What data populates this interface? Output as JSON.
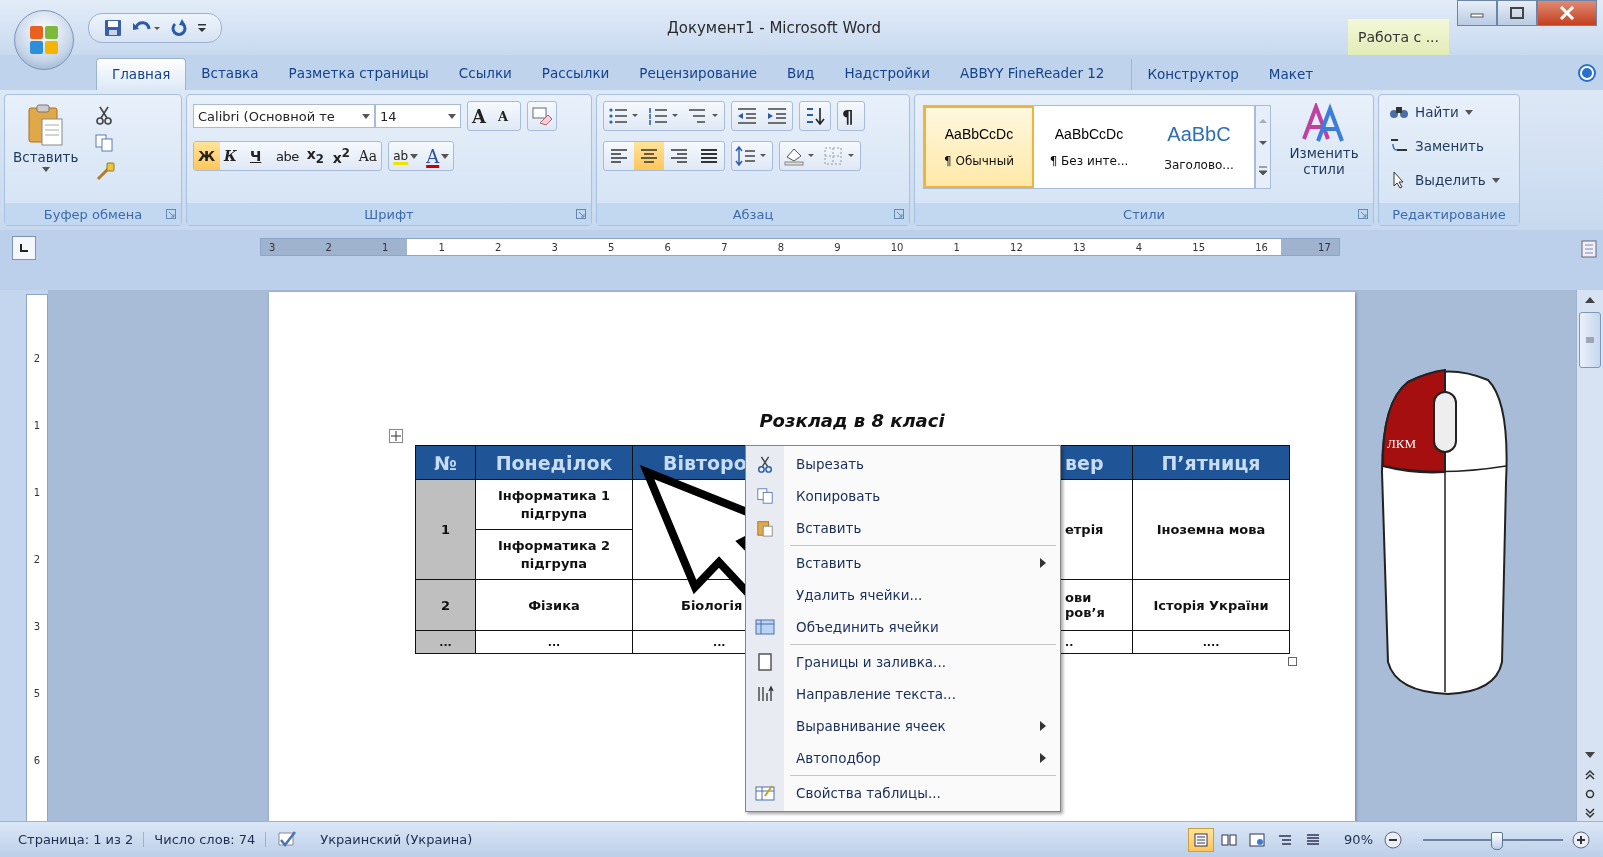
{
  "window": {
    "title": "Документ1 - Microsoft Word",
    "context_group": "Работа с ..."
  },
  "tabs": [
    {
      "label": "Главная",
      "selected": true
    },
    {
      "label": "Вставка",
      "selected": false
    },
    {
      "label": "Разметка страницы",
      "selected": false
    },
    {
      "label": "Ссылки",
      "selected": false
    },
    {
      "label": "Рассылки",
      "selected": false
    },
    {
      "label": "Рецензирование",
      "selected": false
    },
    {
      "label": "Вид",
      "selected": false
    },
    {
      "label": "Надстройки",
      "selected": false
    },
    {
      "label": "ABBYY FineReader 12",
      "selected": false
    }
  ],
  "context_tabs": [
    {
      "label": "Конструктор",
      "selected": false
    },
    {
      "label": "Макет",
      "selected": false
    }
  ],
  "ribbon": {
    "clipboard": {
      "label": "Буфер обмена",
      "paste": "Вставить"
    },
    "font": {
      "label": "Шрифт",
      "font_name": "Calibri (Основной те",
      "font_size": "14",
      "grow": "A",
      "shrink": "A",
      "buttons": [
        {
          "label": "Ж",
          "kind": "bold",
          "selected": true
        },
        {
          "label": "К",
          "kind": "italic",
          "selected": false
        },
        {
          "label": "Ч",
          "kind": "underline",
          "selected": false
        },
        {
          "label": "abe",
          "kind": "strike",
          "selected": false
        },
        {
          "label": "x$_{2}$",
          "kind": "sub",
          "selected": false
        },
        {
          "label": "x$^{2}$",
          "kind": "sup",
          "selected": false
        },
        {
          "label": "Aa",
          "kind": "case",
          "selected": false
        }
      ],
      "highlight": "ab",
      "font_color": "A"
    },
    "paragraph": {
      "label": "Абзац",
      "marks": "¶",
      "align": [
        {
          "kind": "left",
          "selected": false
        },
        {
          "kind": "center",
          "selected": true
        },
        {
          "kind": "right",
          "selected": false
        },
        {
          "kind": "justify",
          "selected": false
        }
      ]
    },
    "styles": {
      "label": "Стили",
      "items": [
        {
          "sample": "AaBbCcDc",
          "name": "¶ Обычный",
          "kind": "body",
          "selected": true
        },
        {
          "sample": "AaBbCcDc",
          "name": "¶ Без инте...",
          "kind": "body",
          "selected": false
        },
        {
          "sample": "AaBbC",
          "name": "Заголово...",
          "kind": "heading",
          "selected": false
        }
      ],
      "change": "Изменить стили"
    },
    "editing": {
      "label": "Редактирование",
      "items": [
        {
          "label": "Найти",
          "kind": "find"
        },
        {
          "label": "Заменить",
          "kind": "replace"
        },
        {
          "label": "Выделить",
          "kind": "select"
        }
      ]
    }
  },
  "ruler": {
    "numbers": [
      "3",
      "2",
      "1",
      "1",
      "2",
      "3",
      "5",
      "6",
      "7",
      "8",
      "9",
      "10",
      "1",
      "12",
      "13",
      "4",
      "15",
      "16",
      "17"
    ],
    "vertical_numbers": [
      "2",
      "1",
      "1",
      "2",
      "3",
      "5",
      "6"
    ]
  },
  "document": {
    "title": "Розклад в 8 класі",
    "header": [
      "№",
      "Понеділок",
      "Вівторо",
      "вер",
      "П’ятниця"
    ],
    "rows": [
      [
        "1",
        [
          "Інформатика 1 підгрупа",
          "Інформатика 2 підгрупа"
        ],
        null,
        "етрія",
        "Іноземна мова"
      ],
      [
        "2",
        "Фізика",
        "Біологія",
        "ови ров’я",
        "Історія України"
      ],
      [
        "...",
        "...",
        "...",
        "..",
        "...."
      ]
    ],
    "mouse_label": "ЛКМ"
  },
  "context_menu": [
    [
      {
        "label": "Вырезать",
        "kind": "cut",
        "submenu": false
      },
      {
        "label": "Копировать",
        "kind": "copy",
        "submenu": false
      },
      {
        "label": "Вставить",
        "kind": "paste",
        "submenu": false
      }
    ],
    [
      {
        "label": "Вставить",
        "kind": "plain",
        "submenu": true
      },
      {
        "label": "Удалить ячейки...",
        "kind": "plain",
        "submenu": false
      },
      {
        "label": "Объединить ячейки",
        "kind": "merge",
        "submenu": false
      }
    ],
    [
      {
        "label": "Границы и заливка...",
        "kind": "borders",
        "submenu": false
      },
      {
        "label": "Направление текста...",
        "kind": "direction",
        "submenu": false
      },
      {
        "label": "Выравнивание ячеек",
        "kind": "plain",
        "submenu": true
      },
      {
        "label": "Автоподбор",
        "kind": "plain",
        "submenu": true
      }
    ],
    [
      {
        "label": "Свойства таблицы...",
        "kind": "properties",
        "submenu": false
      }
    ]
  ],
  "status_bar": {
    "page": "Страница: 1 из 2",
    "words": "Число слов: 74",
    "language": "Украинский (Украина)",
    "views": [
      {
        "kind": "print",
        "selected": true
      },
      {
        "kind": "reading",
        "selected": false
      },
      {
        "kind": "web",
        "selected": false
      },
      {
        "kind": "outline",
        "selected": false
      },
      {
        "kind": "draft",
        "selected": false
      }
    ],
    "zoom": "90%",
    "zoom_slider": {
      "level": 0.52
    }
  }
}
